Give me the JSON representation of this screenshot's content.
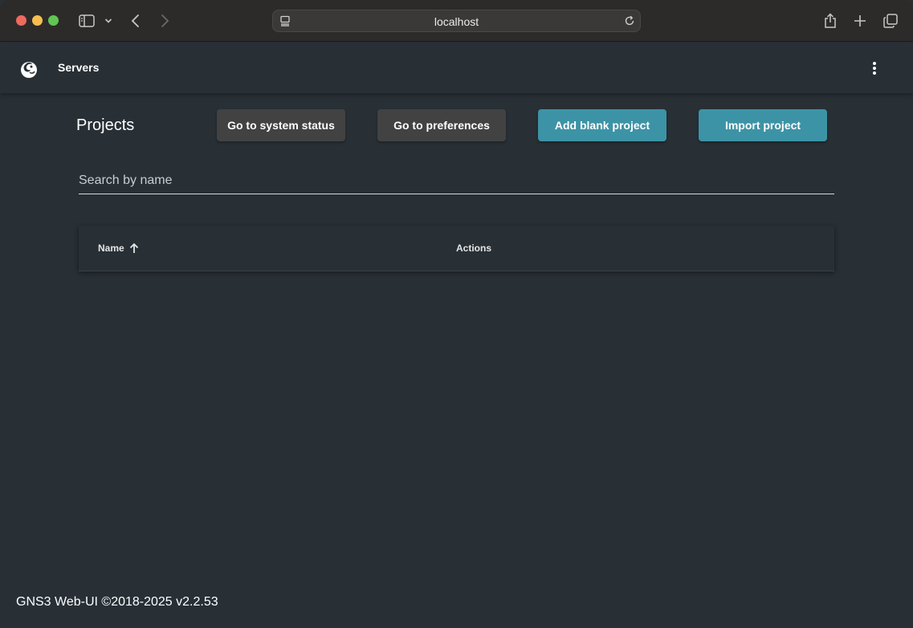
{
  "browser": {
    "address": "localhost"
  },
  "app": {
    "title": "Servers"
  },
  "page": {
    "title": "Projects",
    "buttons": {
      "system_status": "Go to system status",
      "preferences": "Go to preferences",
      "add_blank": "Add blank project",
      "import": "Import project"
    },
    "search": {
      "placeholder": "Search by name",
      "value": ""
    },
    "table": {
      "columns": [
        "Name",
        "Actions"
      ],
      "sort": {
        "column": "Name",
        "direction": "ascending"
      },
      "rows": []
    }
  },
  "footer": {
    "text": "GNS3 Web-UI ©2018-2025 v2.2.53"
  },
  "colors": {
    "background": "#283036",
    "accent_button": "#3d93a6",
    "dark_button": "#424242"
  },
  "icons": [
    "sidebar-icon",
    "chevron-down-icon",
    "back-icon",
    "forward-icon",
    "page-icon",
    "reload-icon",
    "share-icon",
    "plus-icon",
    "tabs-icon",
    "gns3-logo-icon",
    "more-vert-icon",
    "arrow-up-icon"
  ]
}
